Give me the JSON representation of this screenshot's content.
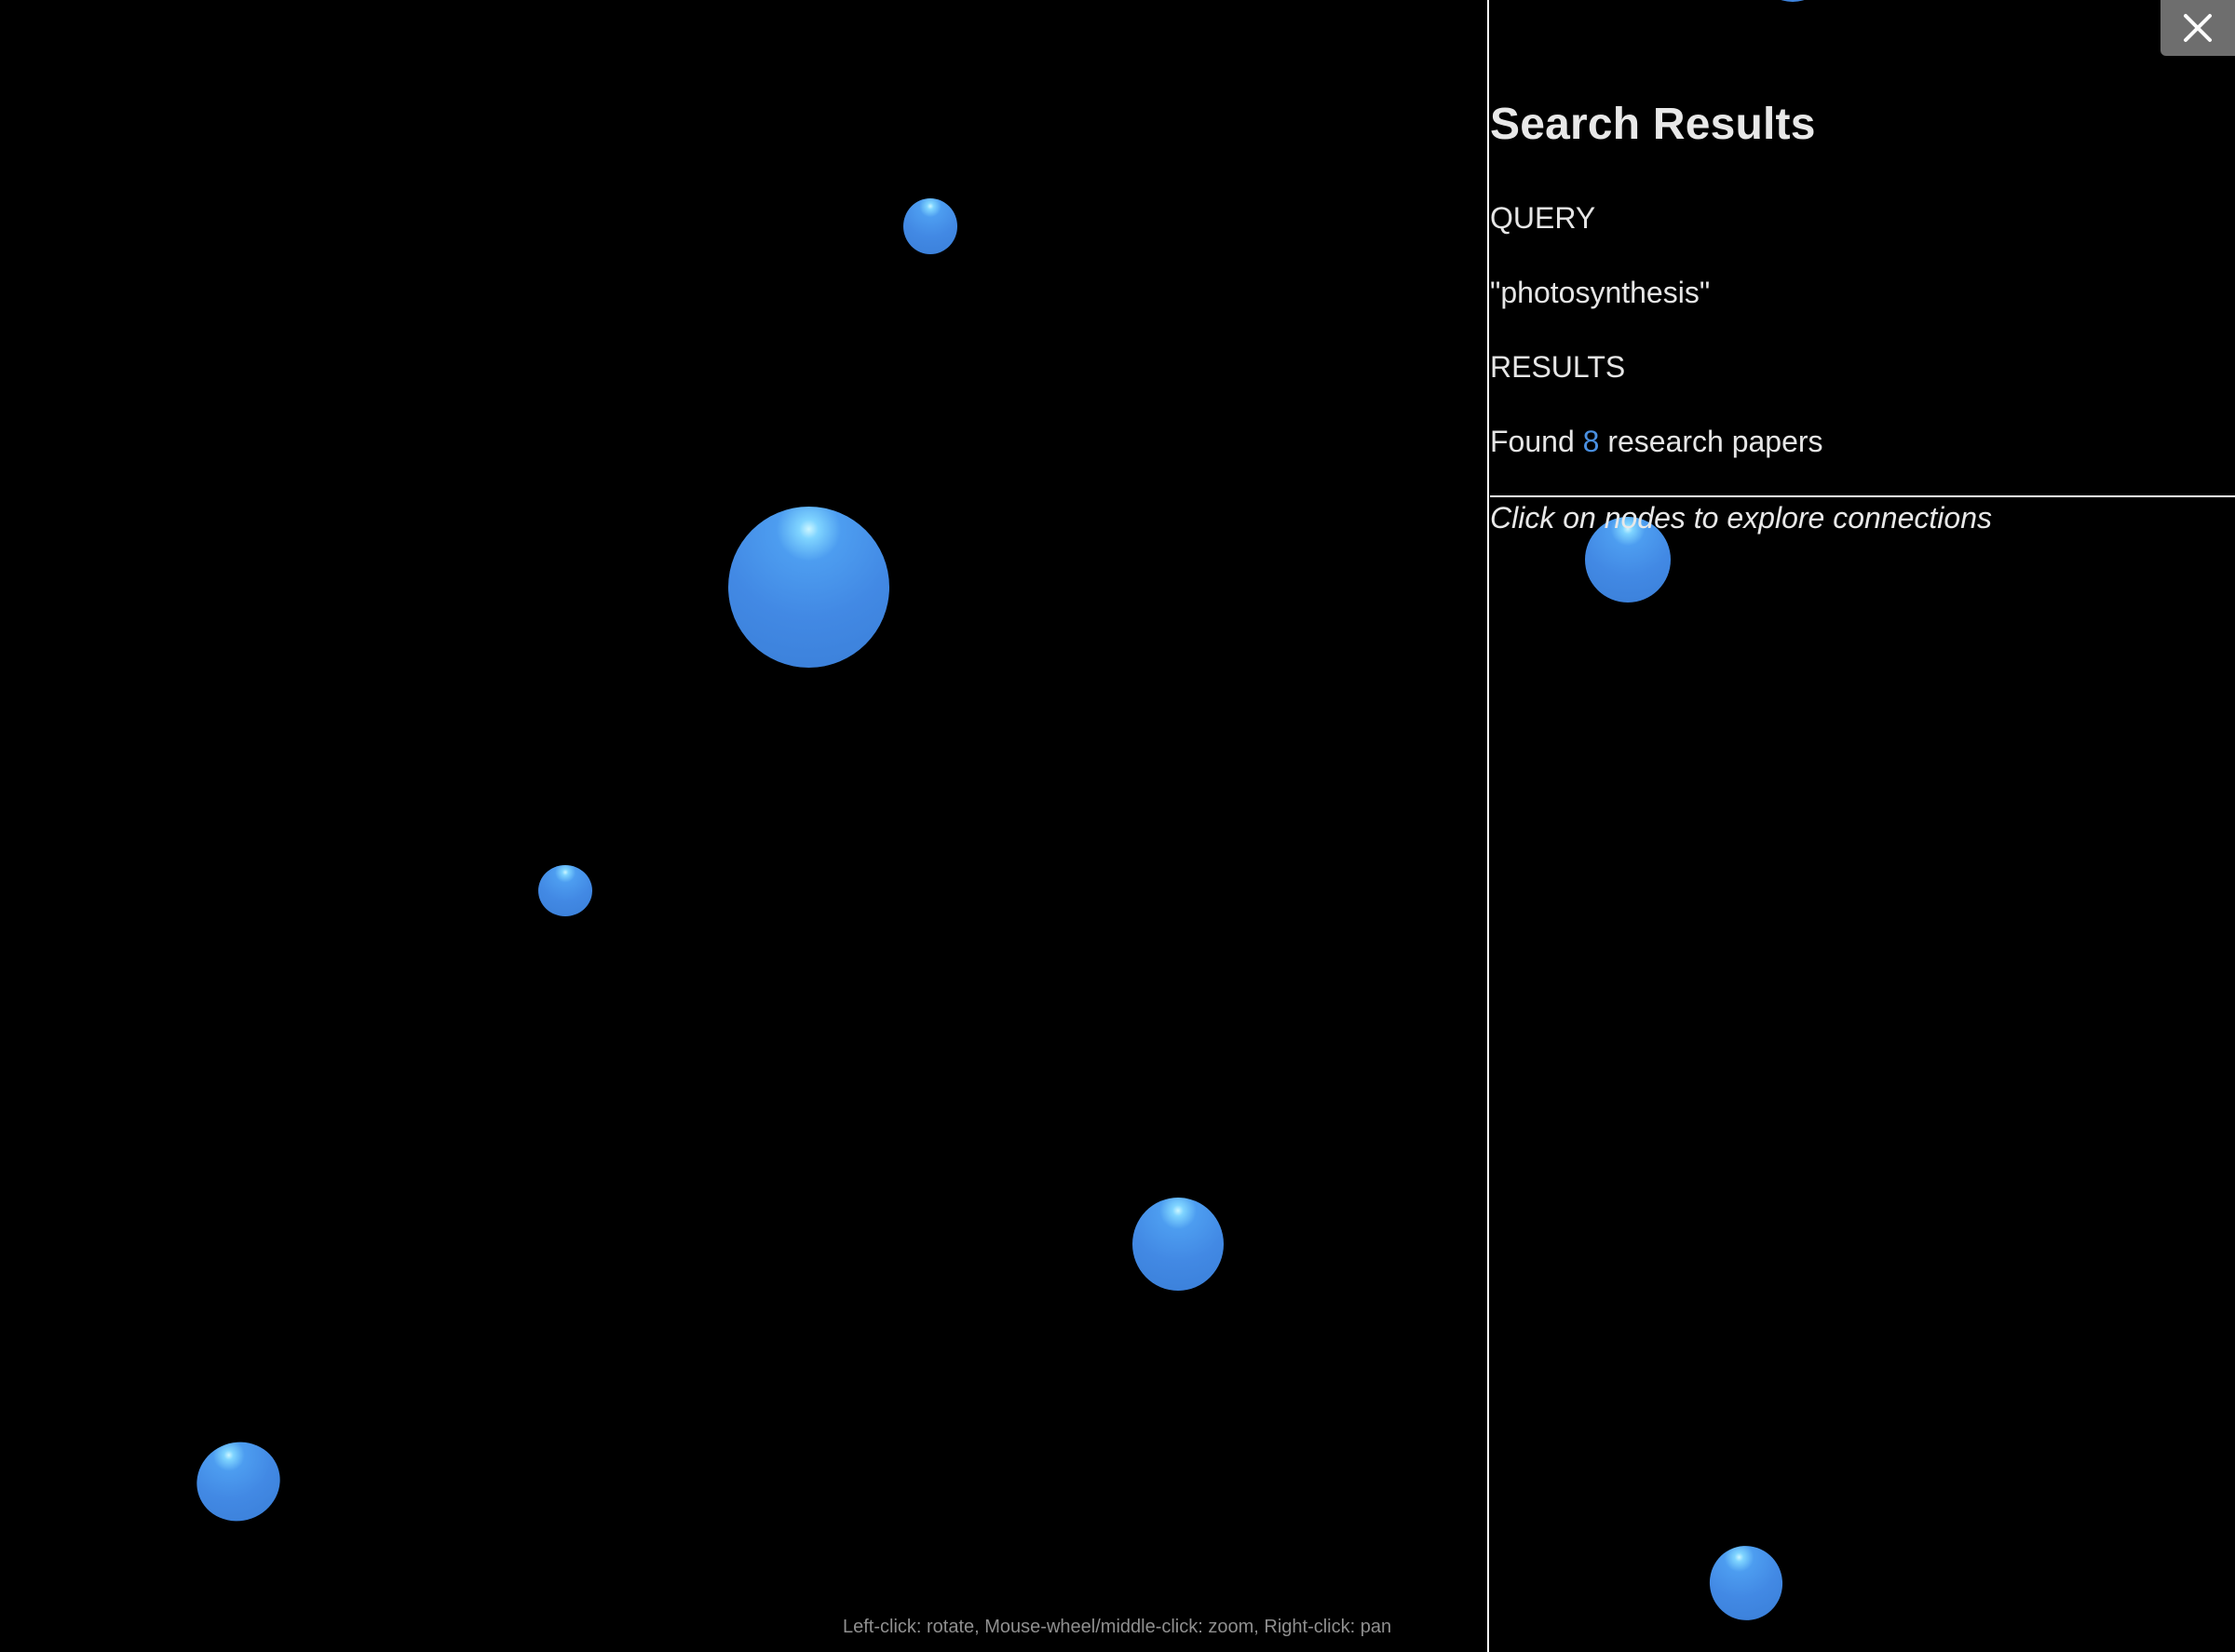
{
  "panel": {
    "title": "Search Results",
    "query_label": "QUERY",
    "query_value": "\"photosynthesis\"",
    "results_label": "RESULTS",
    "results_prefix": "Found ",
    "results_count": "8",
    "results_suffix": " research papers",
    "hint": "Click on nodes to explore connections"
  },
  "close_button": {
    "icon": "close-icon"
  },
  "controls_help": "Left-click: rotate, Mouse-wheel/middle-click: zoom, Right-click: pan",
  "colors": {
    "background": "#000000",
    "node": "#4289e4",
    "node_highlight": "#cdf6ff",
    "accent": "#4a90e2",
    "close_button_bg": "#6e6e6e",
    "divider": "#ffffff"
  }
}
